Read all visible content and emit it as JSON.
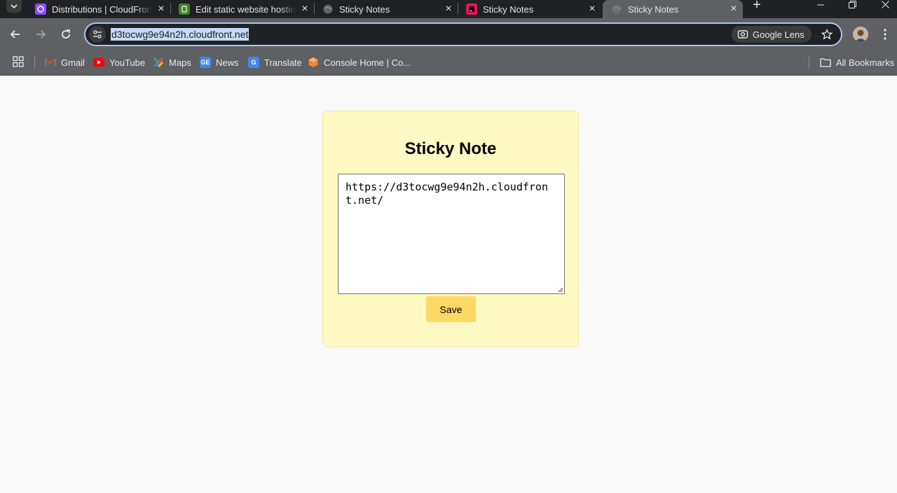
{
  "browser": {
    "tabs": [
      {
        "title": "Distributions | CloudFront",
        "favicon": "cloudfront-icon",
        "favicon_color": "#8c4fff",
        "active": false
      },
      {
        "title": "Edit static website hosting",
        "favicon": "s3-icon",
        "favicon_color": "#3f8624",
        "active": false
      },
      {
        "title": "Sticky Notes",
        "favicon": "globe-icon",
        "favicon_color": "#5f6368",
        "active": false
      },
      {
        "title": "Sticky Notes",
        "favicon": "intellij-icon",
        "favicon_color": "#e8145a",
        "active": false
      },
      {
        "title": "Sticky Notes",
        "favicon": "globe-icon",
        "favicon_color": "#5f6368",
        "active": true
      }
    ],
    "url": "d3tocwg9e94n2h.cloudfront.net",
    "lens_label": "Google Lens",
    "bookmarks": [
      {
        "label": "Gmail",
        "icon": "gmail-icon"
      },
      {
        "label": "YouTube",
        "icon": "youtube-icon"
      },
      {
        "label": "Maps",
        "icon": "maps-icon"
      },
      {
        "label": "News",
        "icon": "news-icon"
      },
      {
        "label": "Translate",
        "icon": "translate-icon"
      },
      {
        "label": "Console Home | Co...",
        "icon": "aws-console-icon"
      }
    ],
    "all_bookmarks_label": "All Bookmarks"
  },
  "page": {
    "heading": "Sticky Note",
    "note_text": "https://d3tocwg9e94n2h.cloudfront.net/",
    "save_label": "Save"
  },
  "colors": {
    "card_background": "#fff9c4",
    "save_button": "#ffd966",
    "page_background": "#f9f9f9"
  }
}
